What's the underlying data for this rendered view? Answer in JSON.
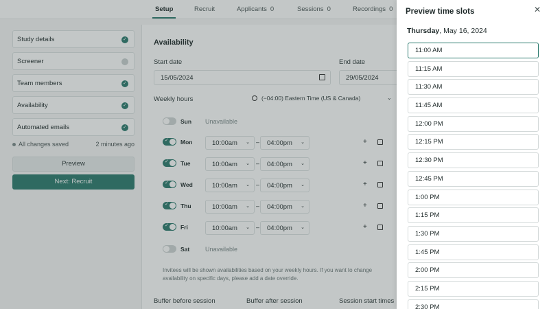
{
  "topnav": {
    "tabs": [
      {
        "label": "Setup"
      },
      {
        "label": "Recruit"
      },
      {
        "label": "Applicants",
        "count": "0"
      },
      {
        "label": "Sessions",
        "count": "0"
      },
      {
        "label": "Recordings",
        "count": "0"
      }
    ]
  },
  "sidebar": {
    "steps": [
      {
        "label": "Study details"
      },
      {
        "label": "Screener"
      },
      {
        "label": "Team members"
      },
      {
        "label": "Availability"
      },
      {
        "label": "Automated emails"
      }
    ],
    "saved_label": "All changes saved",
    "saved_time": "2 minutes ago",
    "preview_label": "Preview",
    "next_label": "Next: Recruit"
  },
  "availability": {
    "title": "Availability",
    "start_label": "Start date",
    "start_value": "15/05/2024",
    "end_label": "End date",
    "end_value": "29/05/2024",
    "weekly_label": "Weekly hours",
    "timezone": "(−04:00) Eastern Time (US & Canada)",
    "unavailable_label": "Unavailable",
    "days": [
      {
        "name": "Sun",
        "on": false
      },
      {
        "name": "Mon",
        "on": true,
        "from": "10:00am",
        "to": "04:00pm"
      },
      {
        "name": "Tue",
        "on": true,
        "from": "10:00am",
        "to": "04:00pm"
      },
      {
        "name": "Wed",
        "on": true,
        "from": "10:00am",
        "to": "04:00pm"
      },
      {
        "name": "Thu",
        "on": true,
        "from": "10:00am",
        "to": "04:00pm"
      },
      {
        "name": "Fri",
        "on": true,
        "from": "10:00am",
        "to": "04:00pm"
      },
      {
        "name": "Sat",
        "on": false
      }
    ],
    "note": "Invitees will be shown availabilities based on your weekly hours. If you want to change availability on specific days, please add a date override.",
    "buffer_before_label": "Buffer before session",
    "buffer_after_label": "Buffer after session",
    "start_times_label": "Session start times"
  },
  "panel": {
    "title": "Preview time slots",
    "weekday": "Thursday",
    "date": ", May 16, 2024",
    "slots": [
      "11:00 AM",
      "11:15 AM",
      "11:30 AM",
      "11:45 AM",
      "12:00 PM",
      "12:15 PM",
      "12:30 PM",
      "12:45 PM",
      "1:00 PM",
      "1:15 PM",
      "1:30 PM",
      "1:45 PM",
      "2:00 PM",
      "2:15 PM",
      "2:30 PM"
    ]
  },
  "colors": {
    "accent": "#2b7a6e",
    "overlay": "#384646"
  }
}
